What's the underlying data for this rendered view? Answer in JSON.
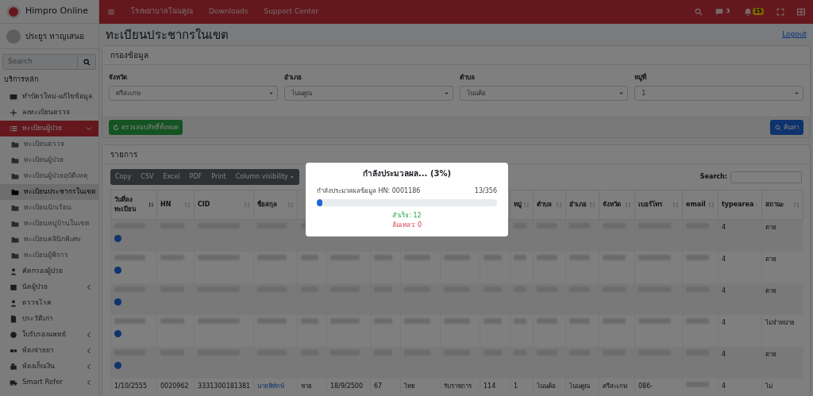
{
  "brand": {
    "name": "Himpro Online"
  },
  "user": {
    "name": "ประยูร หาญเสนอ"
  },
  "sidebar_search": {
    "placeholder": "Search"
  },
  "sidebar": {
    "header": "บริการหลัก",
    "items": [
      {
        "label": "ทำบัตรใหม่-แก้ไขข้อมูล",
        "selected": false
      },
      {
        "label": "ลงทะเบียนตรวจ",
        "selected": false
      },
      {
        "label": "ทะเบียนผู้ป่วย",
        "selected": true,
        "expanded": true,
        "children": [
          {
            "label": "ทะเบียนตรวจ",
            "selected": false
          },
          {
            "label": "ทะเบียนผู้ป่วย",
            "selected": false
          },
          {
            "label": "ทะเบียนผู้ป่วยอุบัติเหตุ",
            "selected": false
          },
          {
            "label": "ทะเบียนประชากรในเขต",
            "selected": true
          },
          {
            "label": "ทะเบียนนักเรียน",
            "selected": false
          },
          {
            "label": "ทะเบียนหมู่บ้านในเขต",
            "selected": false
          },
          {
            "label": "ทะเบียนคลินิกพิเศษ",
            "selected": false
          },
          {
            "label": "ทะเบียนผู้พิการ",
            "selected": false
          }
        ]
      },
      {
        "label": "คัดกรองผู้ป่วย",
        "selected": false
      },
      {
        "label": "นัดผู้ป่วย",
        "selected": false,
        "expanded": false
      },
      {
        "label": "ตรวจโรค",
        "selected": false
      },
      {
        "label": "ประวัติเก่า",
        "selected": false
      },
      {
        "label": "ใบรับรองแพทย์",
        "selected": false,
        "expanded": false
      },
      {
        "label": "ห้องจ่ายยา",
        "selected": false,
        "expanded": false
      },
      {
        "label": "ห้องเก็บเงิน",
        "selected": false,
        "expanded": false
      },
      {
        "label": "Smart Refer",
        "selected": false,
        "expanded": false
      }
    ]
  },
  "navbar": {
    "links": [
      "โรงพยาบาลโนนคูณ",
      "Downloads",
      "Support Center"
    ],
    "messages_badge": "3",
    "notifications_badge": "15"
  },
  "page_title": "ทะเบียนประชากรในเขต",
  "logout": "Logout",
  "filter": {
    "title": "กรองข้อมูล",
    "fields": [
      {
        "label": "จังหวัด",
        "value": "ศรีสะเกษ"
      },
      {
        "label": "อำเภอ",
        "value": "โนนคูณ"
      },
      {
        "label": "ตำบล",
        "value": "โนนค้อ"
      },
      {
        "label": "หมู่ที่",
        "value": "1"
      }
    ],
    "check_button": "ตรวจสอบสิทธิ์ทั้งหมด",
    "search_button": "ค้นหา"
  },
  "list": {
    "title": "รายการ",
    "export_buttons": [
      "Copy",
      "CSV",
      "Excel",
      "PDF",
      "Print"
    ],
    "column_visibility": "Column visibility",
    "search_label": "Search:",
    "columns": [
      {
        "label": "วันที่ลงทะเบียน"
      },
      {
        "label": "HN"
      },
      {
        "label": "CID"
      },
      {
        "label": "ชื่อสกุล"
      },
      {},
      {},
      {},
      {},
      {},
      {},
      {
        "label": "หมู่"
      },
      {
        "label": "ตำบล"
      },
      {
        "label": "อำเภอ"
      },
      {
        "label": "จังหวัด"
      },
      {
        "label": "เบอร์โทร"
      },
      {
        "label": "email"
      },
      {
        "label": "typearea"
      },
      {
        "label": "สถานะ"
      }
    ],
    "rows": [
      {
        "cells": [
          null,
          null,
          null,
          null,
          null,
          null,
          null,
          null,
          null,
          null,
          null,
          null,
          null,
          null,
          null,
          null,
          "4",
          "ตาย"
        ]
      },
      {
        "cells": [
          null,
          null,
          null,
          null,
          null,
          null,
          null,
          null,
          null,
          null,
          null,
          null,
          null,
          null,
          null,
          null,
          "4",
          "ตาย"
        ]
      },
      {
        "cells": [
          null,
          null,
          null,
          null,
          null,
          null,
          null,
          null,
          null,
          null,
          null,
          null,
          null,
          null,
          null,
          null,
          "4",
          "ตาย"
        ]
      },
      {
        "cells": [
          null,
          null,
          null,
          null,
          null,
          null,
          null,
          null,
          null,
          null,
          null,
          null,
          null,
          null,
          null,
          null,
          "4",
          "ไม่จำหน่าย"
        ]
      },
      {
        "cells": [
          null,
          null,
          null,
          null,
          null,
          null,
          null,
          null,
          null,
          null,
          null,
          null,
          null,
          null,
          null,
          null,
          "4",
          "ตาย"
        ]
      },
      {
        "cells": [
          "1/10/2555",
          "0020962",
          "3331300181381",
          "นายพิทักษ์",
          "ชาย",
          "18/9/2500",
          "67",
          "ไทย",
          "รับราชการ",
          "114",
          "1",
          "โนนค้อ",
          "โนนคูณ",
          "ศรีสะเกษ",
          "086-",
          null,
          "4",
          "ไม่"
        ]
      }
    ]
  },
  "progress_modal": {
    "title": "กำลังประมวลผล... (3%)",
    "status": "กำลังประมวลผลข้อมูล HN: 0001186",
    "count": "13/356",
    "level": 0.03,
    "success": "สำเร็จ: 12",
    "failed": "ล้มเหลว: 0"
  }
}
